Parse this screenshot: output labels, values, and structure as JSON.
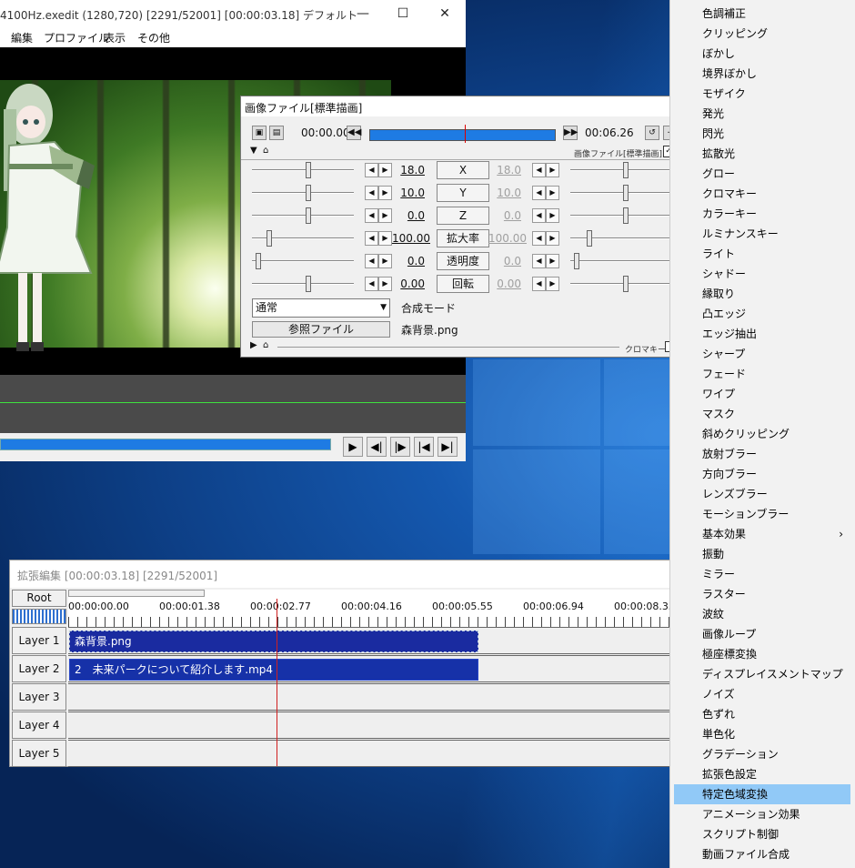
{
  "main_window": {
    "title": "4100Hz.exedit (1280,720)  [2291/52001] [00:00:03.18]  デフォルト",
    "controls": {
      "minimize": "—",
      "maximize": "☐",
      "close": "✕"
    },
    "menu": [
      "編集",
      "プロファイル",
      "表示",
      "その他"
    ],
    "playback_buttons": [
      "▶",
      "◀|",
      "|▶",
      "|◀",
      "▶|"
    ]
  },
  "dialog": {
    "title": "画像ファイル[標準描画]",
    "time_start": "00:00.00",
    "time_end": "00:06.26",
    "header_label": "画像ファイル[標準描画]",
    "params": [
      {
        "name": "X",
        "left_value": "18.0",
        "right_value": "18.0"
      },
      {
        "name": "Y",
        "left_value": "10.0",
        "right_value": "10.0"
      },
      {
        "name": "Z",
        "left_value": "0.0",
        "right_value": "0.0"
      },
      {
        "name": "拡大率",
        "left_value": "100.00",
        "right_value": "100.00"
      },
      {
        "name": "透明度",
        "left_value": "0.0",
        "right_value": "0.0"
      },
      {
        "name": "回転",
        "left_value": "0.00",
        "right_value": "0.00"
      }
    ],
    "blend_mode_value": "通常",
    "blend_mode_label": "合成モード",
    "reference_button": "参照ファイル",
    "filename": "森背景.png",
    "chromakey_label": "クロマキー"
  },
  "timeline": {
    "title": "拡張編集 [00:00:03.18] [2291/52001]",
    "root_label": "Root",
    "ruler_labels": [
      "00:00:00.00",
      "00:00:01.38",
      "00:00:02.77",
      "00:00:04.16",
      "00:00:05.55",
      "00:00:06.94",
      "00:00:08.33"
    ],
    "layers": [
      "Layer 1",
      "Layer 2",
      "Layer 3",
      "Layer 4",
      "Layer 5"
    ],
    "clips": [
      {
        "label": "森背景.png"
      },
      {
        "label": "2　未来パークについて紹介します.mp4"
      }
    ]
  },
  "context_menu": {
    "items": [
      {
        "label": "色調補正"
      },
      {
        "label": "クリッピング"
      },
      {
        "label": "ぼかし"
      },
      {
        "label": "境界ぼかし"
      },
      {
        "label": "モザイク"
      },
      {
        "label": "発光"
      },
      {
        "label": "閃光"
      },
      {
        "label": "拡散光"
      },
      {
        "label": "グロー"
      },
      {
        "label": "クロマキー"
      },
      {
        "label": "カラーキー"
      },
      {
        "label": "ルミナンスキー"
      },
      {
        "label": "ライト"
      },
      {
        "label": "シャドー"
      },
      {
        "label": "縁取り"
      },
      {
        "label": "凸エッジ"
      },
      {
        "label": "エッジ抽出"
      },
      {
        "label": "シャープ"
      },
      {
        "label": "フェード"
      },
      {
        "label": "ワイプ"
      },
      {
        "label": "マスク"
      },
      {
        "label": "斜めクリッピング"
      },
      {
        "label": "放射ブラー"
      },
      {
        "label": "方向ブラー"
      },
      {
        "label": "レンズブラー"
      },
      {
        "label": "モーションブラー"
      },
      {
        "label": "基本効果",
        "submenu": "›"
      },
      {
        "label": "振動"
      },
      {
        "label": "ミラー"
      },
      {
        "label": "ラスター"
      },
      {
        "label": "波紋"
      },
      {
        "label": "画像ループ"
      },
      {
        "label": "極座標変換"
      },
      {
        "label": "ディスプレイスメントマップ"
      },
      {
        "label": "ノイズ"
      },
      {
        "label": "色ずれ"
      },
      {
        "label": "単色化"
      },
      {
        "label": "グラデーション"
      },
      {
        "label": "拡張色設定"
      },
      {
        "label": "特定色域変換",
        "selected": true
      },
      {
        "label": "アニメーション効果"
      },
      {
        "label": "スクリプト制御"
      },
      {
        "label": "動画ファイル合成"
      }
    ]
  },
  "colors": {
    "accent_blue": "#1e7be3",
    "clip_blue": "#1a2ba0",
    "menu_highlight": "#91c9f7",
    "cursor_red": "#d02020"
  }
}
